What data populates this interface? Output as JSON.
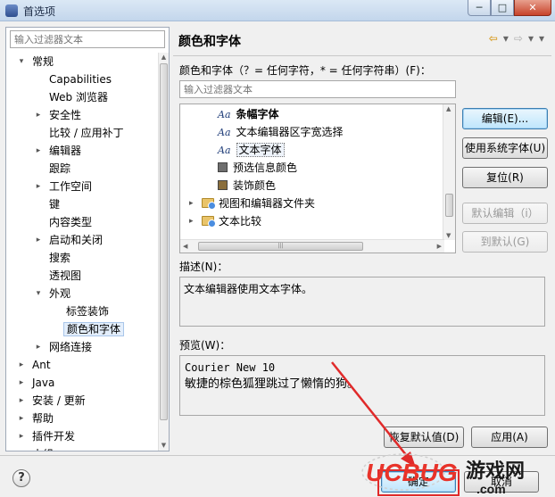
{
  "window": {
    "title": "首选项",
    "minimize_glyph": "─",
    "maximize_glyph": "□",
    "close_glyph": "✕"
  },
  "left": {
    "filter_placeholder": "输入过滤器文本",
    "tree": [
      {
        "label": "常规",
        "depth": 0,
        "expander": "▾"
      },
      {
        "label": "Capabilities",
        "depth": 1,
        "expander": ""
      },
      {
        "label": "Web 浏览器",
        "depth": 1,
        "expander": ""
      },
      {
        "label": "安全性",
        "depth": 1,
        "expander": "▸"
      },
      {
        "label": "比较 / 应用补丁",
        "depth": 1,
        "expander": ""
      },
      {
        "label": "编辑器",
        "depth": 1,
        "expander": "▸"
      },
      {
        "label": "跟踪",
        "depth": 1,
        "expander": ""
      },
      {
        "label": "工作空间",
        "depth": 1,
        "expander": "▸"
      },
      {
        "label": "键",
        "depth": 1,
        "expander": ""
      },
      {
        "label": "内容类型",
        "depth": 1,
        "expander": ""
      },
      {
        "label": "启动和关闭",
        "depth": 1,
        "expander": "▸"
      },
      {
        "label": "搜索",
        "depth": 1,
        "expander": ""
      },
      {
        "label": "透视图",
        "depth": 1,
        "expander": ""
      },
      {
        "label": "外观",
        "depth": 1,
        "expander": "▾"
      },
      {
        "label": "标签装饰",
        "depth": 2,
        "expander": ""
      },
      {
        "label": "颜色和字体",
        "depth": 2,
        "expander": "",
        "selected": true
      },
      {
        "label": "网络连接",
        "depth": 1,
        "expander": "▸"
      },
      {
        "label": "Ant",
        "depth": 0,
        "expander": "▸"
      },
      {
        "label": "Java",
        "depth": 0,
        "expander": "▸"
      },
      {
        "label": "安装 / 更新",
        "depth": 0,
        "expander": "▸"
      },
      {
        "label": "帮助",
        "depth": 0,
        "expander": "▸"
      },
      {
        "label": "插件开发",
        "depth": 0,
        "expander": "▸"
      },
      {
        "label": "小组",
        "depth": 0,
        "expander": "▸"
      }
    ]
  },
  "right": {
    "title": "颜色和字体",
    "nav": {
      "back": "⇦",
      "back_menu": "▾",
      "forward": "⇨",
      "forward_menu": "▾",
      "view_menu": "▾"
    },
    "prompt_label": "颜色和字体（？= 任何字符，* = 任何字符串）(F)：",
    "filter_placeholder": "输入过滤器文本",
    "font_tree": [
      {
        "kind": "font",
        "label": "条幅字体",
        "indent": 1,
        "bold": true
      },
      {
        "kind": "font",
        "label": "文本编辑器区字宽选择",
        "indent": 1,
        "bold": false
      },
      {
        "kind": "font",
        "label": "文本字体",
        "indent": 1,
        "selected": true
      },
      {
        "kind": "color",
        "label": "预选信息颜色",
        "indent": 1,
        "color": "#6e6e6e"
      },
      {
        "kind": "color",
        "label": "装饰颜色",
        "indent": 1,
        "color": "#8a6e3c"
      },
      {
        "kind": "folder",
        "label": "视图和编辑器文件夹",
        "indent": 0,
        "expander": "▸"
      },
      {
        "kind": "folder",
        "label": "文本比较",
        "indent": 0,
        "expander": "▸"
      }
    ],
    "font_glyph": "Aa",
    "buttons": {
      "edit": "编辑(E)...",
      "use_system_font": "使用系统字体(U)",
      "reset": "复位(R)",
      "edit_default": "默认编辑（i）",
      "goto_default": "到默认(G)"
    },
    "desc_label": "描述(N)：",
    "desc_text": "文本编辑器使用文本字体。",
    "preview_label": "预览(W)：",
    "preview_line1": "Courier New 10",
    "preview_line2": "敏捷的棕色狐狸跳过了懒惰的狗。",
    "restore_defaults": "恢复默认值(D)",
    "apply": "应用(A)"
  },
  "bottom": {
    "help": "?",
    "ok": "确定",
    "cancel": "取消"
  },
  "watermark": {
    "brand": "UCBUG",
    "cn": "游戏网",
    "domain": ".com"
  },
  "colors": {
    "annotation_red": "#e02a2a",
    "selection": "#e3eefb",
    "accent": "#3c7fb1"
  }
}
